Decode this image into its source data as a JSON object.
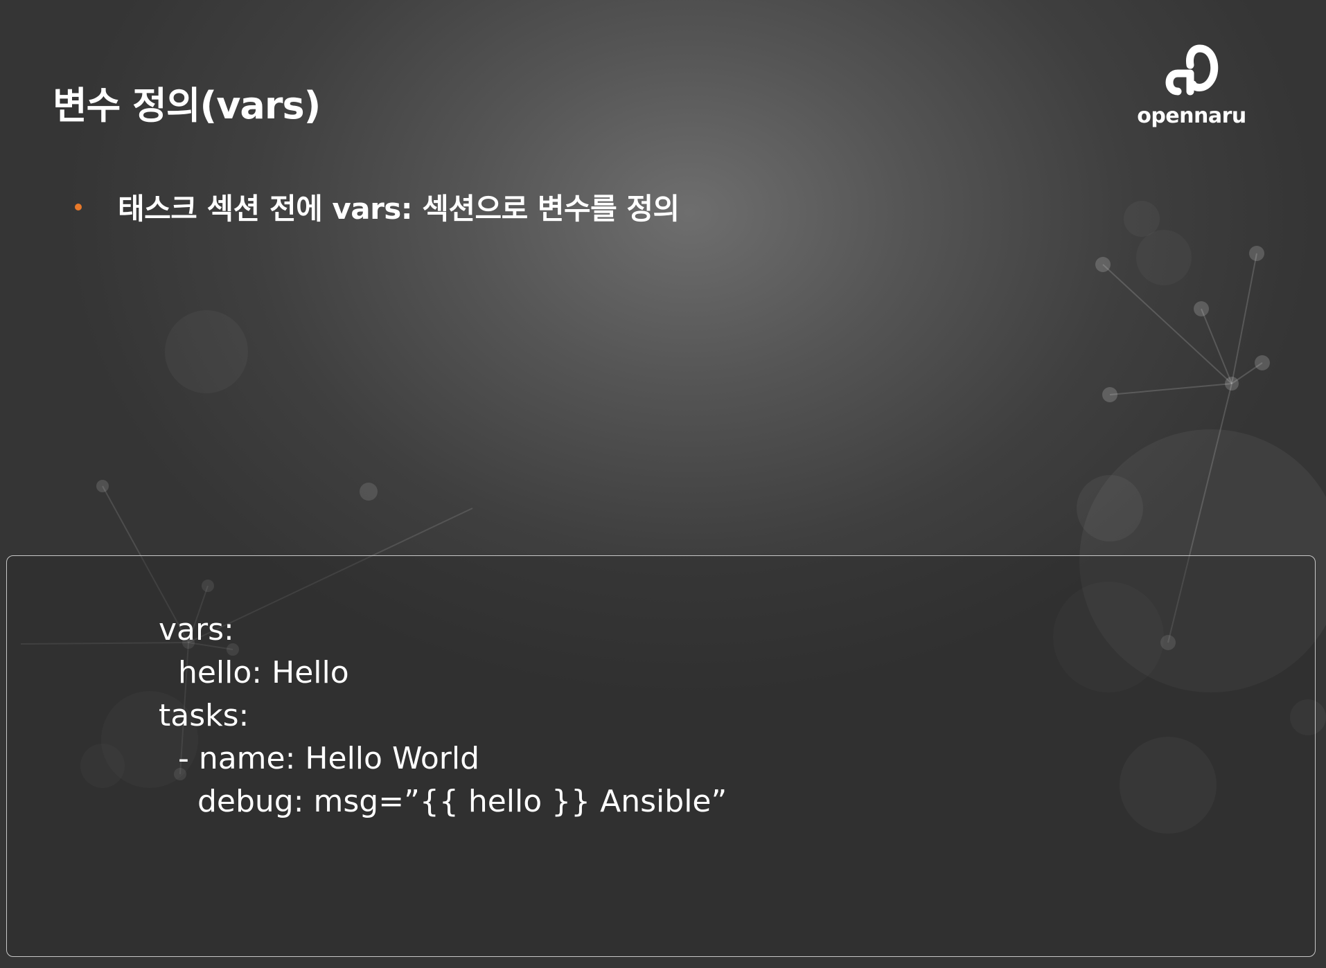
{
  "slide": {
    "title": "변수 정의(vars)",
    "bullet": "태스크 섹션 전에 vars: 섹션으로 변수를 정의",
    "bullet_color": "#e8792a"
  },
  "logo": {
    "text": "opennaru",
    "icon": "opennaru-logo-icon"
  },
  "code": {
    "lines": [
      "vars:",
      "  hello: Hello",
      "tasks:",
      "  - name: Hello World",
      "    debug: msg=”{{ hello }} Ansible”"
    ]
  }
}
